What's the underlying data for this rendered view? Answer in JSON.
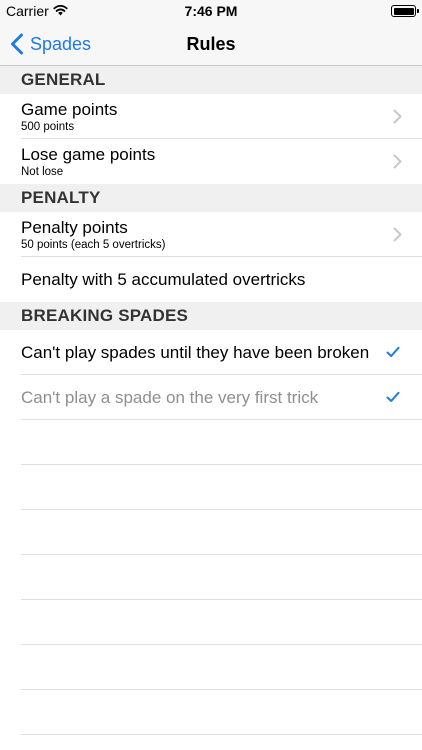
{
  "status_bar": {
    "carrier": "Carrier",
    "time": "7:46 PM",
    "wifi_icon": "wifi-icon",
    "battery_icon": "battery-icon"
  },
  "nav": {
    "back_label": "Spades",
    "title": "Rules",
    "accent_color": "#1f7ae6"
  },
  "sections": {
    "general": {
      "header": "GENERAL",
      "game_points": {
        "title": "Game points",
        "value": "500 points"
      },
      "lose_game_points": {
        "title": "Lose game points",
        "value": "Not lose"
      }
    },
    "penalty": {
      "header": "PENALTY",
      "penalty_points": {
        "title": "Penalty points",
        "value": "50 points (each 5 overtricks)"
      },
      "penalty_accumulated": {
        "title": "Penalty with 5 accumulated overtricks"
      }
    },
    "breaking_spades": {
      "header": "BREAKING SPADES",
      "until_broken": {
        "title": "Can't play spades until they have been broken",
        "checked": true
      },
      "first_trick": {
        "title": "Can't play a spade on the very first trick",
        "checked": true,
        "disabled": true
      }
    }
  }
}
